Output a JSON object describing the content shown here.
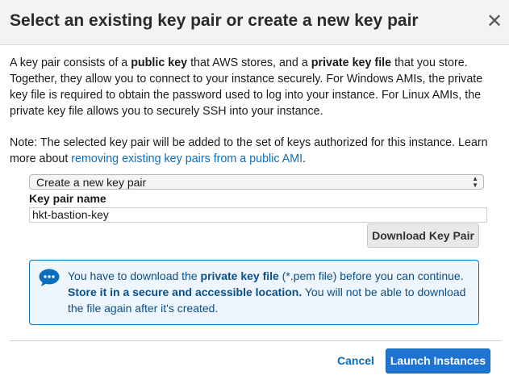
{
  "dialog": {
    "title": "Select an existing key pair or create a new key pair",
    "close_glyph": "✕",
    "close_icon": "close-icon"
  },
  "intro": {
    "t1": "A key pair consists of a ",
    "b1": "public key",
    "t2": " that AWS stores, and a ",
    "b2": "private key file",
    "t3": " that you store. Together, they allow you to connect to your instance securely. For Windows AMIs, the private key file is required to obtain the password used to log into your instance. For Linux AMIs, the private key file allows you to securely SSH into your instance."
  },
  "note": {
    "t1": "Note: The selected key pair will be added to the set of keys authorized for this instance. Learn more about ",
    "link": "removing existing key pairs from a public AMI",
    "t2": "."
  },
  "form": {
    "select_value": "Create a new key pair",
    "label": "Key pair name",
    "name_value": "hkt-bastion-key",
    "download_label": "Download Key Pair"
  },
  "info": {
    "icon": "chat-bubble-icon",
    "t1": "You have to download the ",
    "b1": "private key file",
    "t2": " (*.pem file) before you can continue. ",
    "b2": "Store it in a secure and accessible location.",
    "t3": " You will not be able to download the file again after it's created."
  },
  "footer": {
    "cancel_label": "Cancel",
    "launch_label": "Launch Instances"
  },
  "colors": {
    "accent": "#1f74d3",
    "link": "#0a6ebd",
    "info_bg": "#eef5fc"
  }
}
